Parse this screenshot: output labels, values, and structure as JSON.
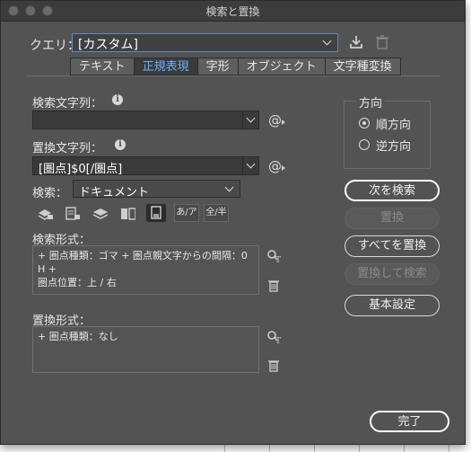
{
  "window": {
    "title": "検索と置換"
  },
  "query": {
    "label": "クエリ：",
    "value": "[カスタム]"
  },
  "tabs": [
    {
      "label": "テキスト",
      "active": false
    },
    {
      "label": "正規表現",
      "active": true
    },
    {
      "label": "字形",
      "active": false
    },
    {
      "label": "オブジェクト",
      "active": false
    },
    {
      "label": "文字種変換",
      "active": false
    }
  ],
  "search_string": {
    "label": "検索文字列：",
    "value": ""
  },
  "replace_string": {
    "label": "置換文字列：",
    "value": "[圏点]$0[/圏点]"
  },
  "scope": {
    "label": "検索：",
    "value": "ドキュメント"
  },
  "options_icons": [
    "lock-layers-icon",
    "locked-stories-icon",
    "hidden-layers-icon",
    "master-pages-icon",
    "footnotes-icon",
    "kana-sensitive-icon",
    "width-sensitive-icon"
  ],
  "option_texts": {
    "kana": "あ/ア",
    "width": "全/半"
  },
  "search_format": {
    "label": "検索形式：",
    "lines": [
      "+ 圏点種類：ゴマ + 圏点親文字からの間隔：0 H +",
      "圏点位置：上 / 右"
    ]
  },
  "replace_format": {
    "label": "置換形式：",
    "lines": [
      "+ 圏点種類：なし"
    ]
  },
  "direction": {
    "label": "方向",
    "forward": "順方向",
    "backward": "逆方向",
    "selected": "forward"
  },
  "buttons": {
    "find_next": "次を検索",
    "replace": "置換",
    "replace_all": "すべてを置換",
    "replace_find": "置換して検索",
    "more_options": "基本設定",
    "done": "完了"
  },
  "at_symbol": "@",
  "colors": {
    "dialog_bg": "#535353",
    "accent": "#6aaef5",
    "focus": "#5a8ad0"
  }
}
